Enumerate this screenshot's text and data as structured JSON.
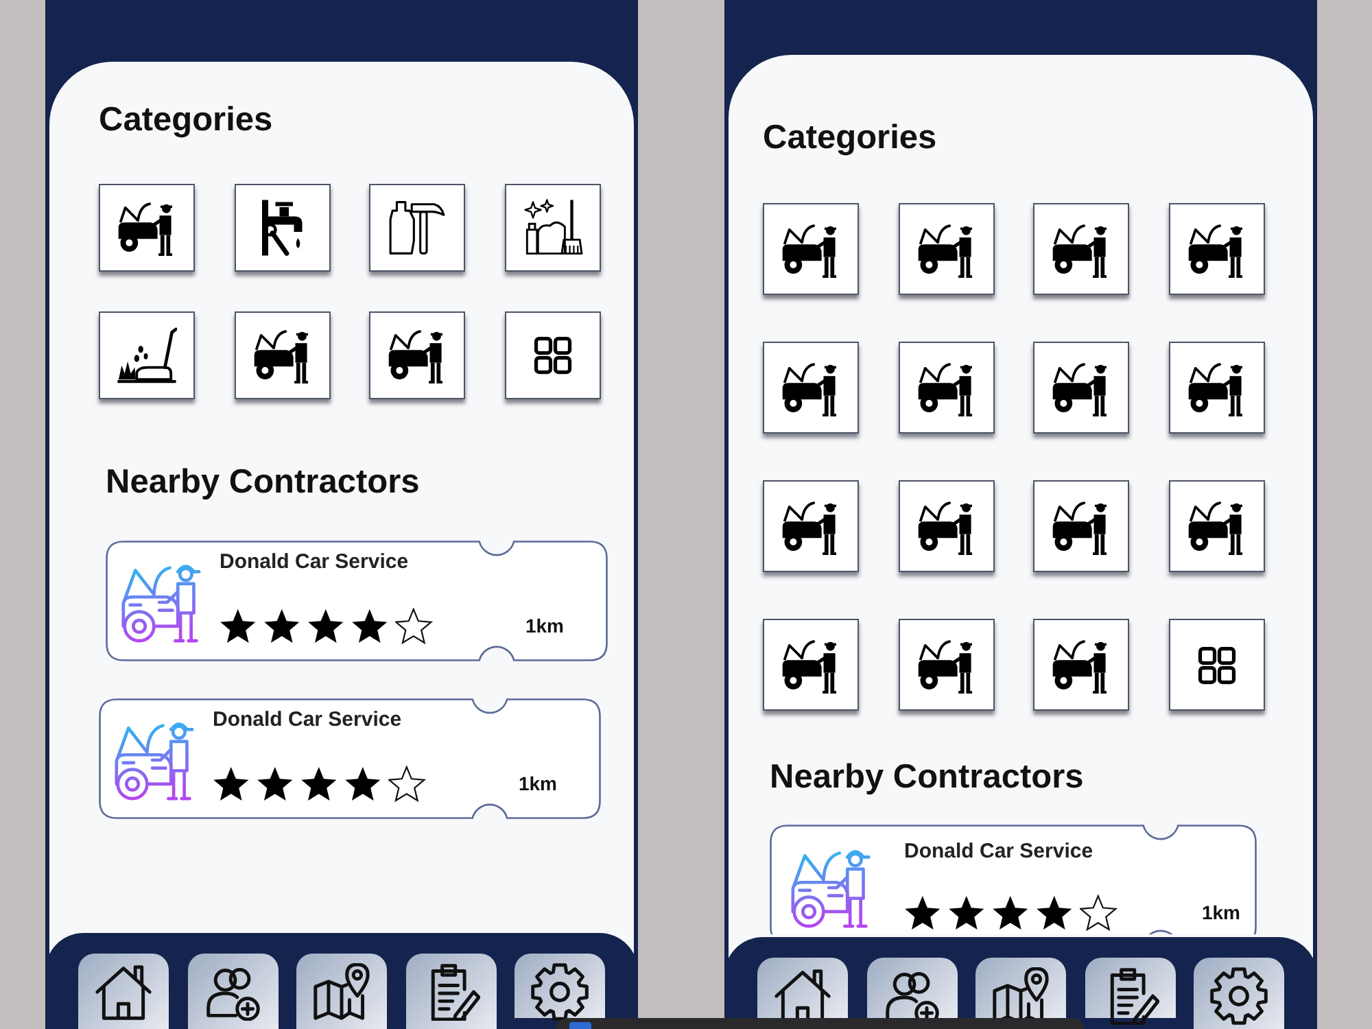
{
  "screens": [
    {
      "categories": {
        "title": "Categories",
        "items": [
          {
            "kind": "mechanic"
          },
          {
            "kind": "plumbing"
          },
          {
            "kind": "tools"
          },
          {
            "kind": "cleaning"
          },
          {
            "kind": "lawn"
          },
          {
            "kind": "mechanic"
          },
          {
            "kind": "mechanic"
          },
          {
            "kind": "more"
          }
        ]
      },
      "contractors": {
        "title": "Nearby Contractors",
        "items": [
          {
            "name": "Donald Car Service",
            "stars": 4,
            "distance": "1km"
          },
          {
            "name": "Donald Car Service",
            "stars": 4,
            "distance": "1km"
          }
        ]
      },
      "nav": [
        {
          "kind": "home"
        },
        {
          "kind": "contacts"
        },
        {
          "kind": "map"
        },
        {
          "kind": "tasks"
        },
        {
          "kind": "settings"
        }
      ]
    },
    {
      "categories": {
        "title": "Categories",
        "items": [
          {
            "kind": "mechanic"
          },
          {
            "kind": "mechanic"
          },
          {
            "kind": "mechanic"
          },
          {
            "kind": "mechanic"
          },
          {
            "kind": "mechanic"
          },
          {
            "kind": "mechanic"
          },
          {
            "kind": "mechanic"
          },
          {
            "kind": "mechanic"
          },
          {
            "kind": "mechanic"
          },
          {
            "kind": "mechanic"
          },
          {
            "kind": "mechanic"
          },
          {
            "kind": "mechanic"
          },
          {
            "kind": "mechanic"
          },
          {
            "kind": "mechanic"
          },
          {
            "kind": "mechanic"
          },
          {
            "kind": "more"
          }
        ]
      },
      "contractors": {
        "title": "Nearby Contractors",
        "items": [
          {
            "name": "Donald Car Service",
            "stars": 4,
            "distance": "1km"
          }
        ]
      },
      "nav": [
        {
          "kind": "home"
        },
        {
          "kind": "contacts"
        },
        {
          "kind": "map"
        },
        {
          "kind": "tasks"
        },
        {
          "kind": "settings"
        }
      ]
    }
  ]
}
